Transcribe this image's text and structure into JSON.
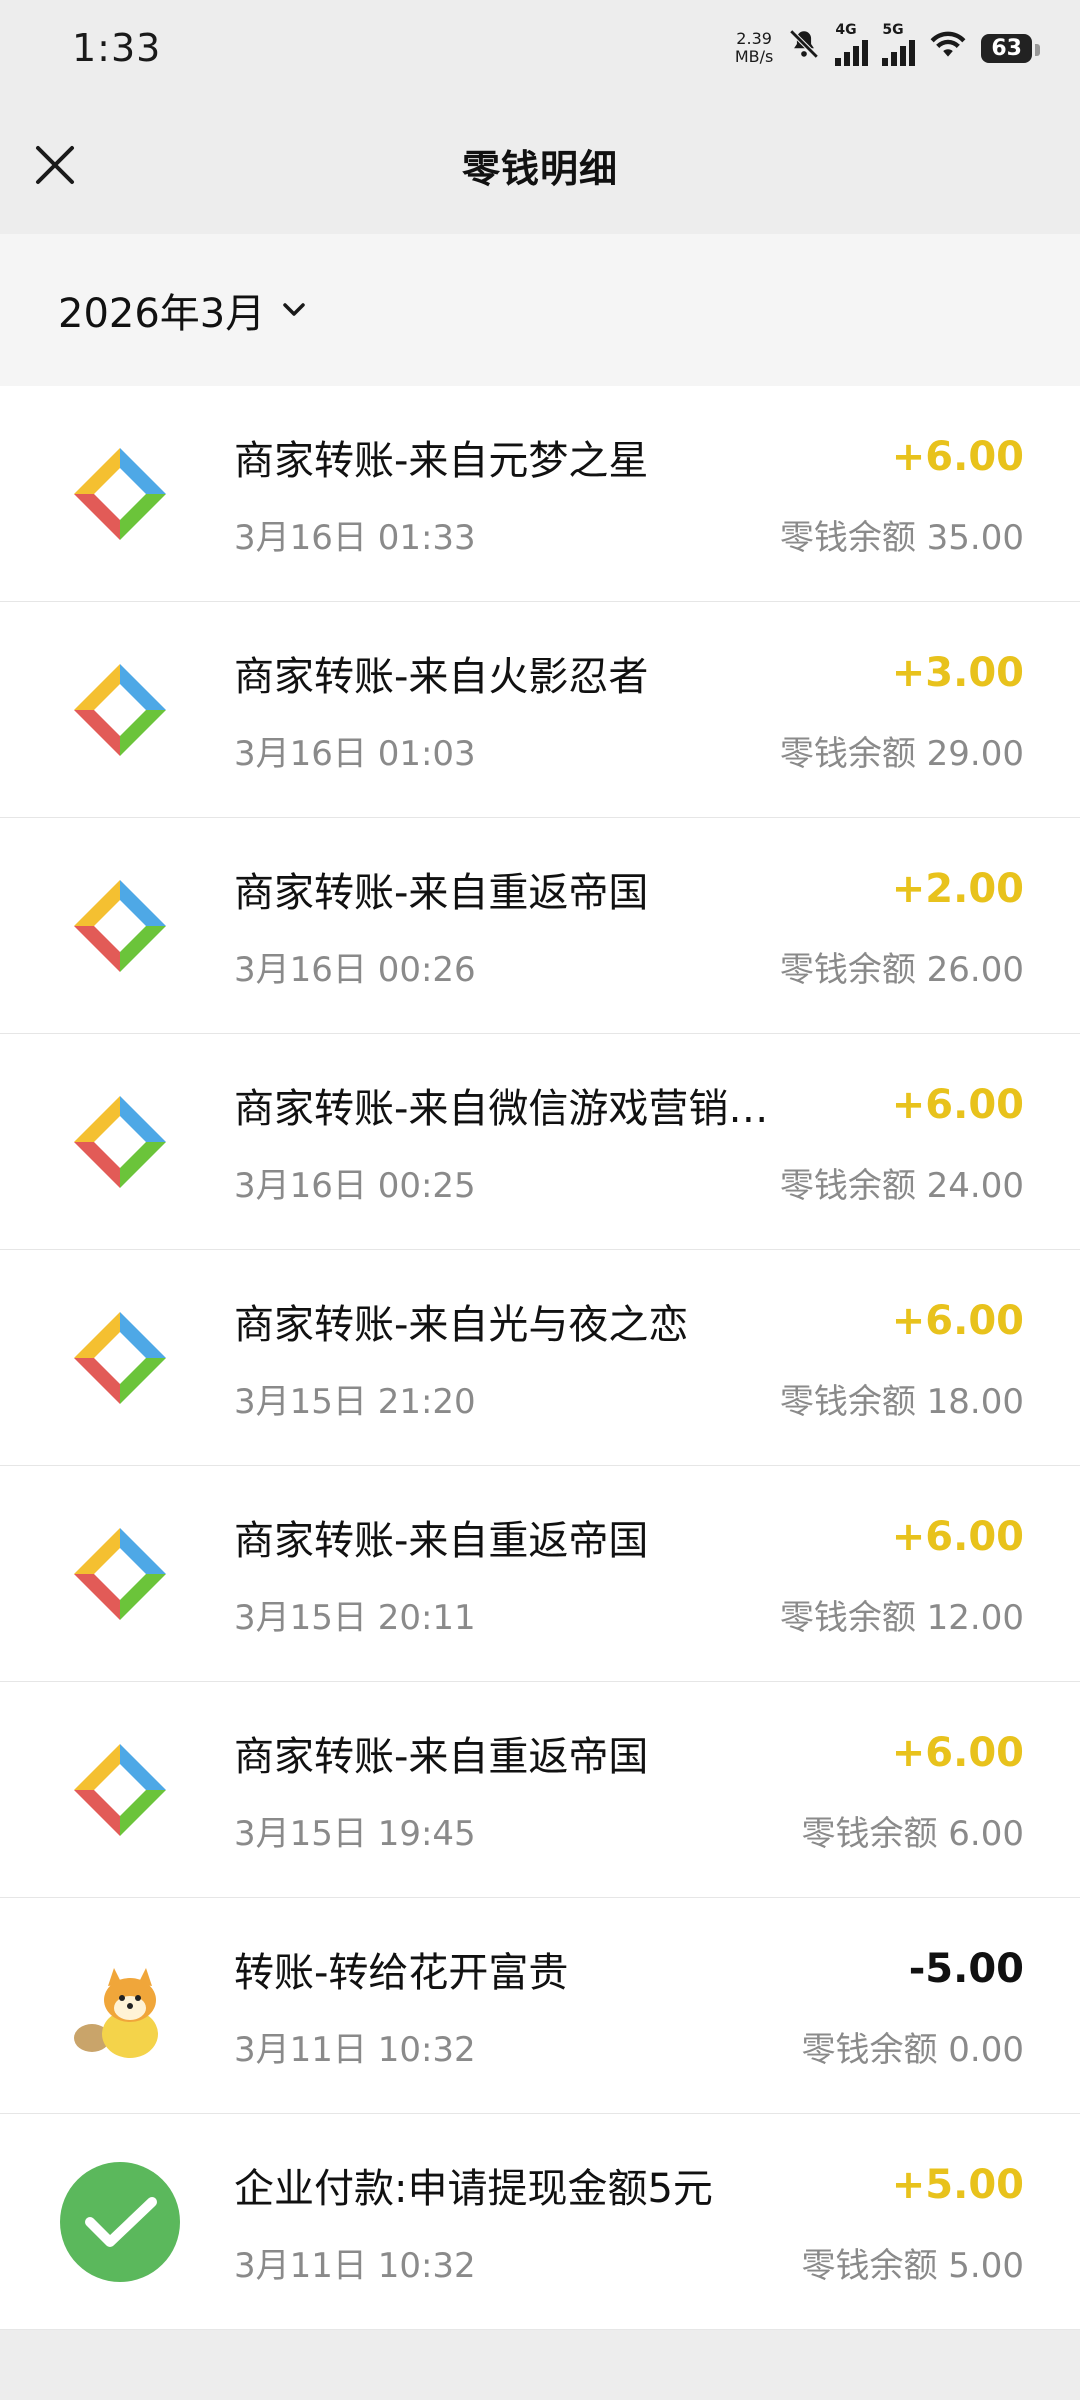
{
  "status_bar": {
    "time": "1:33",
    "net_speed_value": "2.39",
    "net_speed_unit": "MB/s",
    "network_1": "4G",
    "network_2": "5G",
    "battery": "63"
  },
  "header": {
    "title": "零钱明细",
    "close_icon": "close-icon"
  },
  "filter": {
    "month": "2026年3月",
    "dropdown_icon": "chevron-down-icon"
  },
  "colors": {
    "income": "#e8c21c",
    "expense": "#111111",
    "secondary_text": "#8a8a8a"
  },
  "transactions": [
    {
      "icon": "merchant-logo-icon",
      "title": "商家转账-来自元梦之星",
      "amount": "+6.00",
      "date": "3月16日 01:33",
      "balance": "零钱余额 35.00",
      "direction": "in"
    },
    {
      "icon": "merchant-logo-icon",
      "title": "商家转账-来自火影忍者",
      "amount": "+3.00",
      "date": "3月16日 01:03",
      "balance": "零钱余额 29.00",
      "direction": "in"
    },
    {
      "icon": "merchant-logo-icon",
      "title": "商家转账-来自重返帝国",
      "amount": "+2.00",
      "date": "3月16日 00:26",
      "balance": "零钱余额 26.00",
      "direction": "in"
    },
    {
      "icon": "merchant-logo-icon",
      "title": "商家转账-来自微信游戏营销…",
      "amount": "+6.00",
      "date": "3月16日 00:25",
      "balance": "零钱余额 24.00",
      "direction": "in"
    },
    {
      "icon": "merchant-logo-icon",
      "title": "商家转账-来自光与夜之恋",
      "amount": "+6.00",
      "date": "3月15日 21:20",
      "balance": "零钱余额 18.00",
      "direction": "in"
    },
    {
      "icon": "merchant-logo-icon",
      "title": "商家转账-来自重返帝国",
      "amount": "+6.00",
      "date": "3月15日 20:11",
      "balance": "零钱余额 12.00",
      "direction": "in"
    },
    {
      "icon": "merchant-logo-icon",
      "title": "商家转账-来自重返帝国",
      "amount": "+6.00",
      "date": "3月15日 19:45",
      "balance": "零钱余额 6.00",
      "direction": "in"
    },
    {
      "icon": "shiba-avatar-icon",
      "title": "转账-转给花开富贵",
      "amount": "-5.00",
      "date": "3月11日 10:32",
      "balance": "零钱余额 0.00",
      "direction": "out"
    },
    {
      "icon": "wechat-pay-icon",
      "title": "企业付款:申请提现金额5元",
      "amount": "+5.00",
      "date": "3月11日 10:32",
      "balance": "零钱余额 5.00",
      "direction": "in"
    }
  ]
}
